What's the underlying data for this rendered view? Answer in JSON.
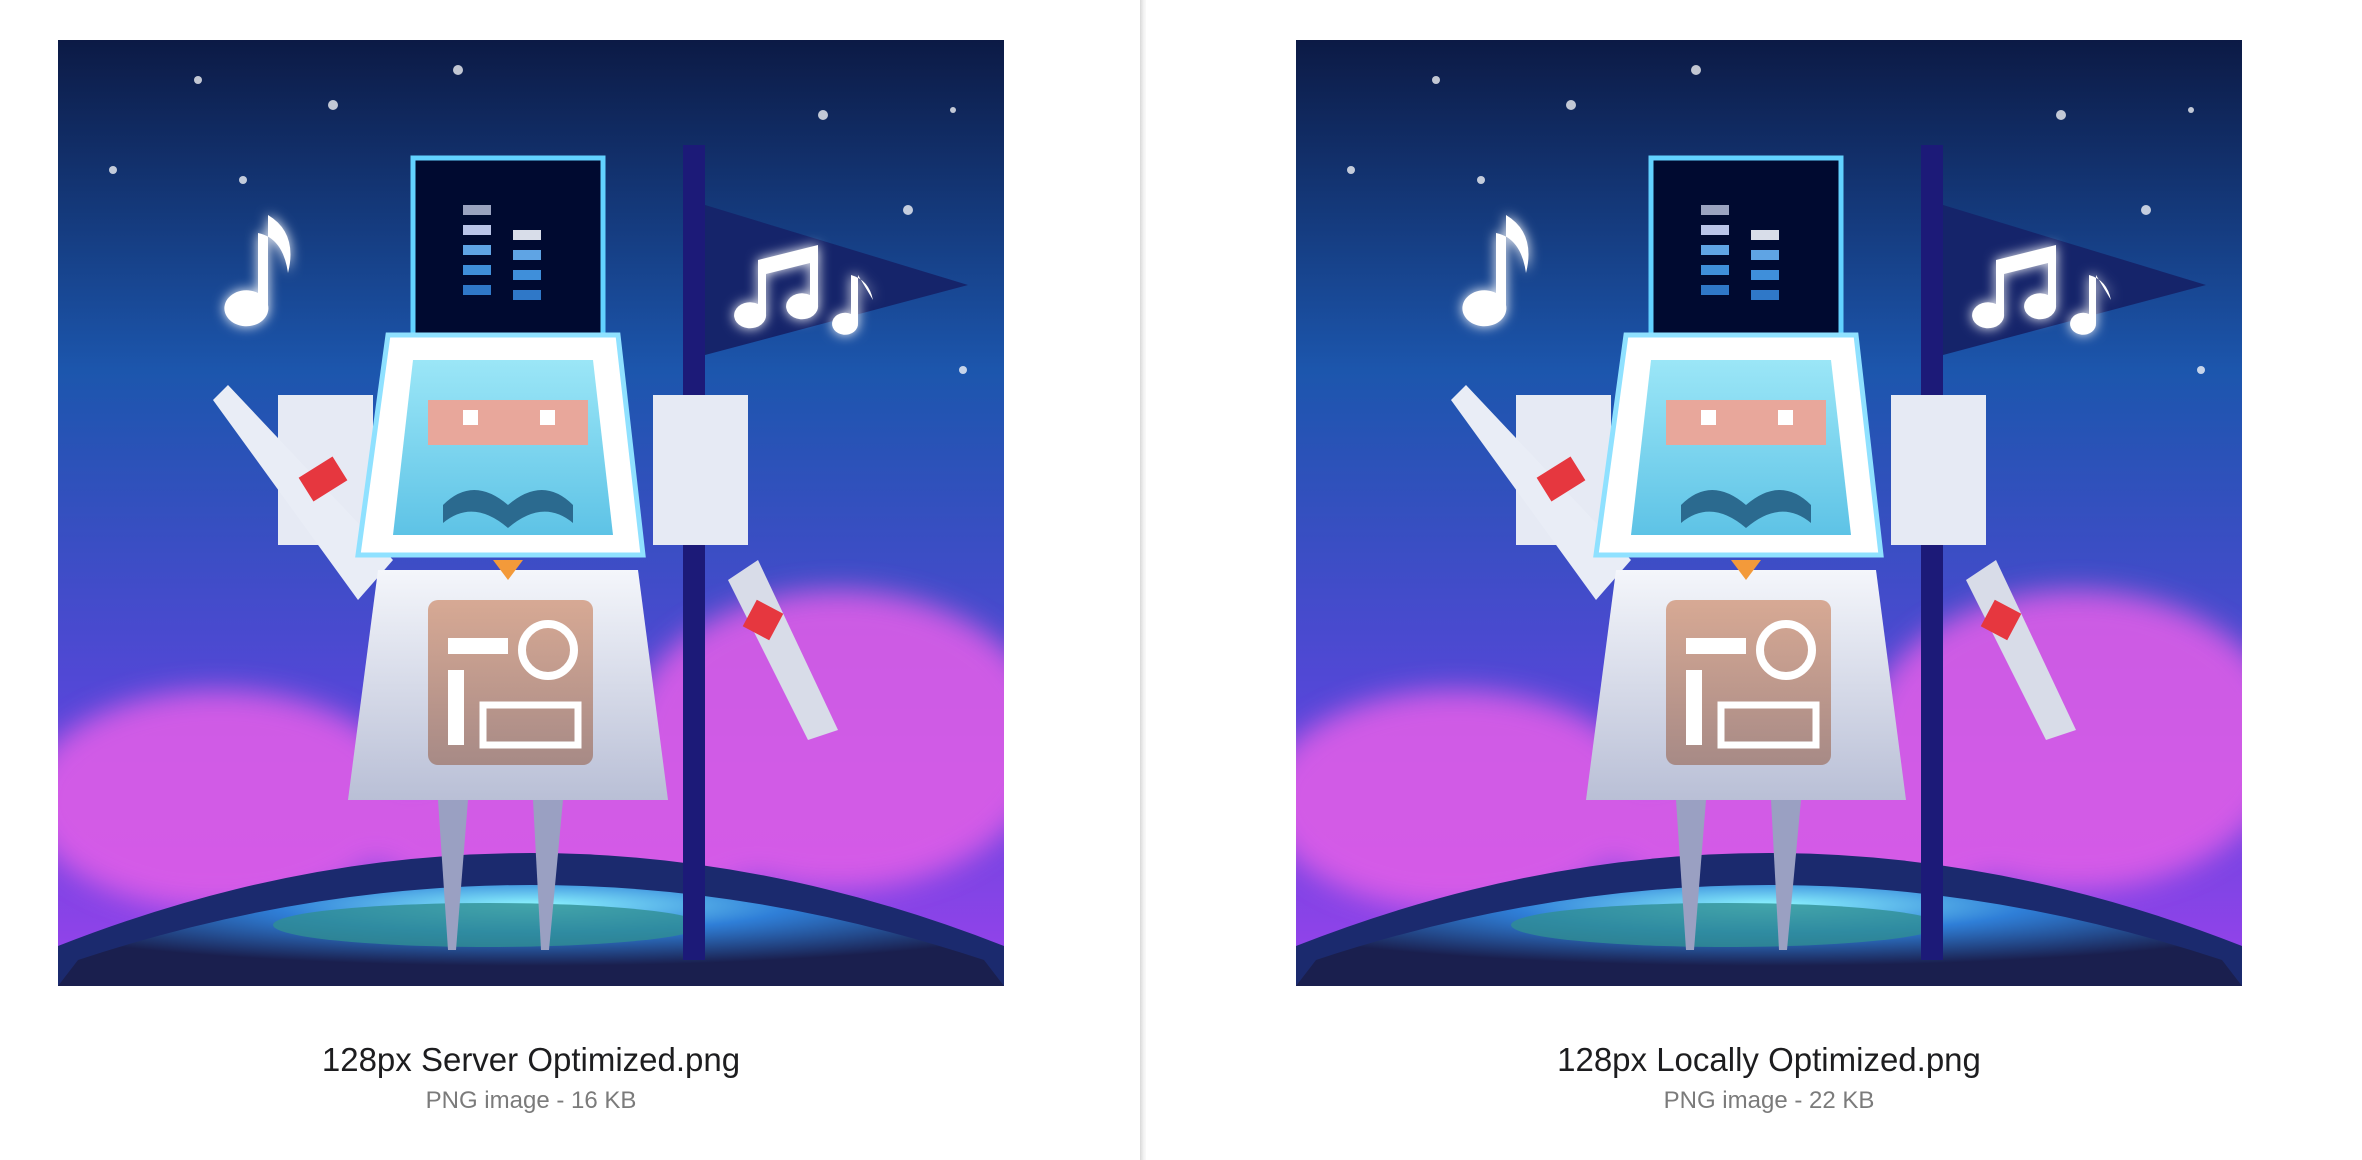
{
  "files": [
    {
      "name": "128px Server Optimized.png",
      "kind": "PNG image",
      "size": "16 KB",
      "meta": "PNG image - 16 KB",
      "icon": "robot-app-icon"
    },
    {
      "name": "128px Locally Optimized.png",
      "kind": "PNG image",
      "size": "22 KB",
      "meta": "PNG image - 22 KB",
      "icon": "robot-app-icon"
    }
  ],
  "colors": {
    "sky_top": "#0d1d4a",
    "sky_mid": "#1e5fb6",
    "sky_bottom": "#8b3fe8",
    "cloud": "#e45ee8",
    "planet": "#1d2f7a",
    "glow": "#7ef0ff",
    "robot_body": "#e8ecf6",
    "visor": "#7fd3ee",
    "panel": "#c79a86",
    "accent_red": "#e6373f",
    "flag_pole": "#1c1a78"
  },
  "grid": {
    "columns": 2
  }
}
